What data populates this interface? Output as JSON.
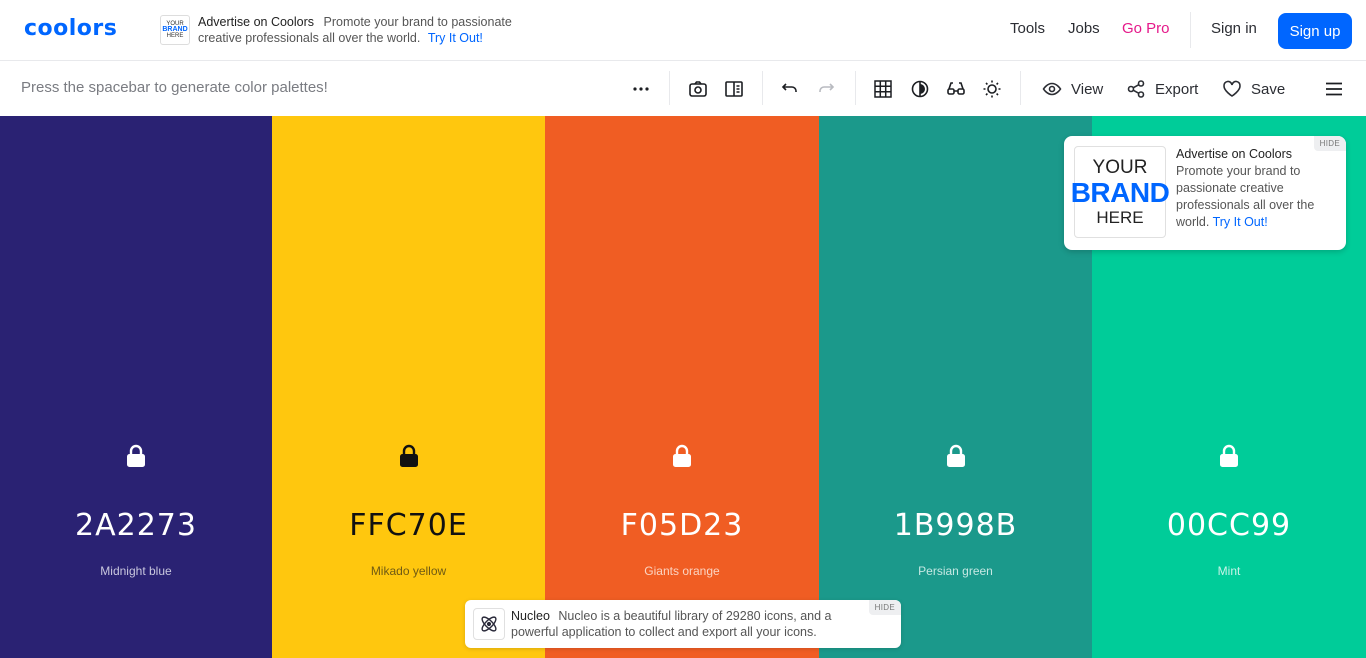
{
  "header": {
    "logo": "coolors",
    "ad": {
      "thumb": [
        "YOUR",
        "BRAND",
        "HERE"
      ],
      "title": "Advertise on Coolors",
      "text": "Promote your brand to passionate creative professionals all over the world.",
      "link": "Try It Out!"
    },
    "nav": {
      "tools": "Tools",
      "jobs": "Jobs",
      "gopro": "Go Pro",
      "signin": "Sign in",
      "signup": "Sign up"
    },
    "accent": "#0066ff",
    "gopro_color": "#e5198a"
  },
  "toolbar": {
    "hint": "Press the spacebar to generate color palettes!",
    "icons": [
      "more-icon",
      "camera-icon",
      "side-panel-icon",
      "undo-icon",
      "redo-icon",
      "grid-icon",
      "contrast-icon",
      "glasses-icon",
      "sun-icon",
      "eye-icon",
      "share-icon",
      "heart-icon",
      "menu-icon"
    ],
    "view": "View",
    "export": "Export",
    "save": "Save"
  },
  "palette": [
    {
      "hex": "2A2273",
      "name": "Midnight blue",
      "bg": "#2a2273",
      "fg": "#ffffff",
      "sub": "#c9c7de"
    },
    {
      "hex": "FFC70E",
      "name": "Mikado yellow",
      "bg": "#ffc70e",
      "fg": "#111111",
      "sub": "#6f5a14"
    },
    {
      "hex": "F05D23",
      "name": "Giants orange",
      "bg": "#f05d23",
      "fg": "#ffffff",
      "sub": "#fbd4c2"
    },
    {
      "hex": "1B998B",
      "name": "Persian green",
      "bg": "#1b998b",
      "fg": "#ffffff",
      "sub": "#c6e8e3"
    },
    {
      "hex": "00CC99",
      "name": "Mint",
      "bg": "#00cc99",
      "fg": "#ffffff",
      "sub": "#c7f3e8"
    }
  ],
  "ad_card": {
    "thumb": [
      "YOUR",
      "BRAND",
      "HERE"
    ],
    "title": "Advertise on Coolors",
    "text": "Promote your brand to passionate creative professionals all over the world.",
    "link": "Try It Out!",
    "hide": "HIDE"
  },
  "bottom_ad": {
    "title": "Nucleo",
    "text": "Nucleo is a beautiful library of 29280 icons, and a powerful application to collect and export all your icons.",
    "hide": "HIDE"
  }
}
